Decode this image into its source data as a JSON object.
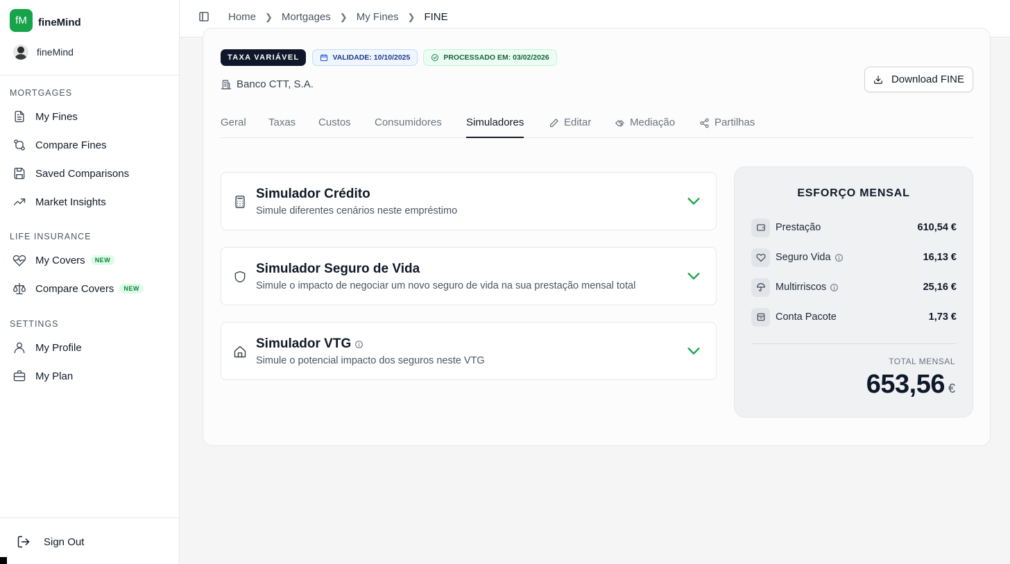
{
  "brand": {
    "logo_text": "fM",
    "name": "fineMind"
  },
  "user": {
    "name": "fineMind"
  },
  "sidebar": {
    "sections": [
      {
        "title": "MORTGAGES",
        "items": [
          {
            "label": "My Fines",
            "icon": "document-icon"
          },
          {
            "label": "Compare Fines",
            "icon": "git-compare-icon"
          },
          {
            "label": "Saved Comparisons",
            "icon": "save-icon"
          },
          {
            "label": "Market Insights",
            "icon": "trending-up-icon"
          }
        ]
      },
      {
        "title": "LIFE INSURANCE",
        "items": [
          {
            "label": "My Covers",
            "icon": "heart-pulse-icon",
            "badge": "NEW"
          },
          {
            "label": "Compare Covers",
            "icon": "scale-icon",
            "badge": "NEW"
          }
        ]
      },
      {
        "title": "SETTINGS",
        "items": [
          {
            "label": "My Profile",
            "icon": "user-icon"
          },
          {
            "label": "My Plan",
            "icon": "briefcase-icon"
          }
        ]
      }
    ],
    "signout": "Sign Out"
  },
  "breadcrumb": [
    "Home",
    "Mortgages",
    "My Fines",
    "FINE"
  ],
  "badges": {
    "rate_type": "TAXA VARIÁVEL",
    "validity": "VALIDADE: 10/10/2025",
    "processed": "PROCESSADO EM: 03/02/2026"
  },
  "bank": "Banco CTT, S.A.",
  "download_label": "Download FINE",
  "tabs": [
    {
      "label": "Geral"
    },
    {
      "label": "Taxas"
    },
    {
      "label": "Custos"
    },
    {
      "label": "Consumidores"
    },
    {
      "label": "Simuladores",
      "active": true
    },
    {
      "label": "Editar",
      "icon": "pencil-icon"
    },
    {
      "label": "Mediação",
      "icon": "handshake-icon"
    },
    {
      "label": "Partilhas",
      "icon": "share-icon"
    }
  ],
  "simulators": [
    {
      "title": "Simulador Crédito",
      "desc": "Simule diferentes cenários neste empréstimo",
      "icon": "calculator-icon"
    },
    {
      "title": "Simulador Seguro de Vida",
      "desc": "Simule o impacto de negociar um novo seguro de vida na sua prestação mensal total",
      "icon": "shield-icon"
    },
    {
      "title": "Simulador VTG",
      "desc": "Simule o potencial impacto dos seguros neste VTG",
      "icon": "home-icon",
      "info": true
    }
  ],
  "esforco": {
    "title": "ESFORÇO MENSAL",
    "rows": [
      {
        "label": "Prestação",
        "value": "610,54 €",
        "icon": "wallet-icon"
      },
      {
        "label": "Seguro Vida",
        "value": "16,13 €",
        "icon": "heart-icon",
        "info": true
      },
      {
        "label": "Multirriscos",
        "value": "25,16 €",
        "icon": "umbrella-icon",
        "info": true
      },
      {
        "label": "Conta Pacote",
        "value": "1,73 €",
        "icon": "archive-icon"
      }
    ],
    "total_label": "TOTAL MENSAL",
    "total_value": "653,56",
    "total_currency": "€"
  },
  "colors": {
    "brand": "#16a34a",
    "chevron": "#16a34a",
    "dark_badge": "#0f172a"
  }
}
